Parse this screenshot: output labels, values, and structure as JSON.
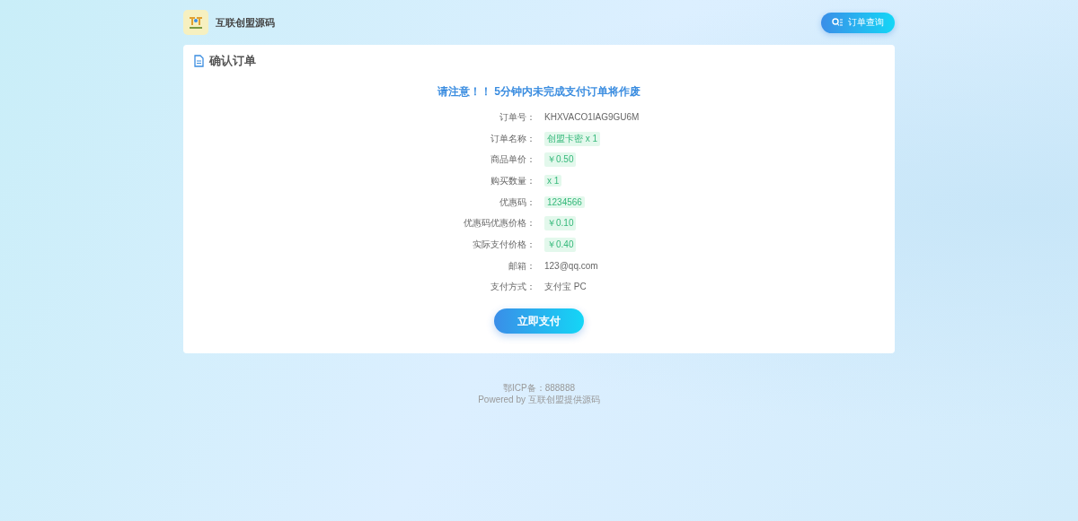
{
  "header": {
    "brand": "互联创盟源码",
    "query_button": "订单查询"
  },
  "card": {
    "title": "确认订单",
    "notice": "请注意！！ 5分钟内未完成支付订单将作废",
    "rows": [
      {
        "label": "订单号：",
        "value": "KHXVACO1IAG9GU6M",
        "kind": "plain"
      },
      {
        "label": "订单名称：",
        "value": "创盟卡密 x 1",
        "kind": "tag"
      },
      {
        "label": "商品单价：",
        "value": "￥0.50",
        "kind": "tag"
      },
      {
        "label": "购买数量：",
        "value": "x 1",
        "kind": "tag"
      },
      {
        "label": "优惠码：",
        "value": "1234566",
        "kind": "tag"
      },
      {
        "label": "优惠码优惠价格：",
        "value": "￥0.10",
        "kind": "tag"
      },
      {
        "label": "实际支付价格：",
        "value": "￥0.40",
        "kind": "tag"
      },
      {
        "label": "邮箱：",
        "value": "123@qq.com",
        "kind": "plain"
      },
      {
        "label": "支付方式：",
        "value": "支付宝 PC",
        "kind": "plain"
      }
    ],
    "pay_button": "立即支付"
  },
  "footer": {
    "icp": "鄂ICP备：888888",
    "powered": "Powered by 互联创盟提供源码"
  }
}
